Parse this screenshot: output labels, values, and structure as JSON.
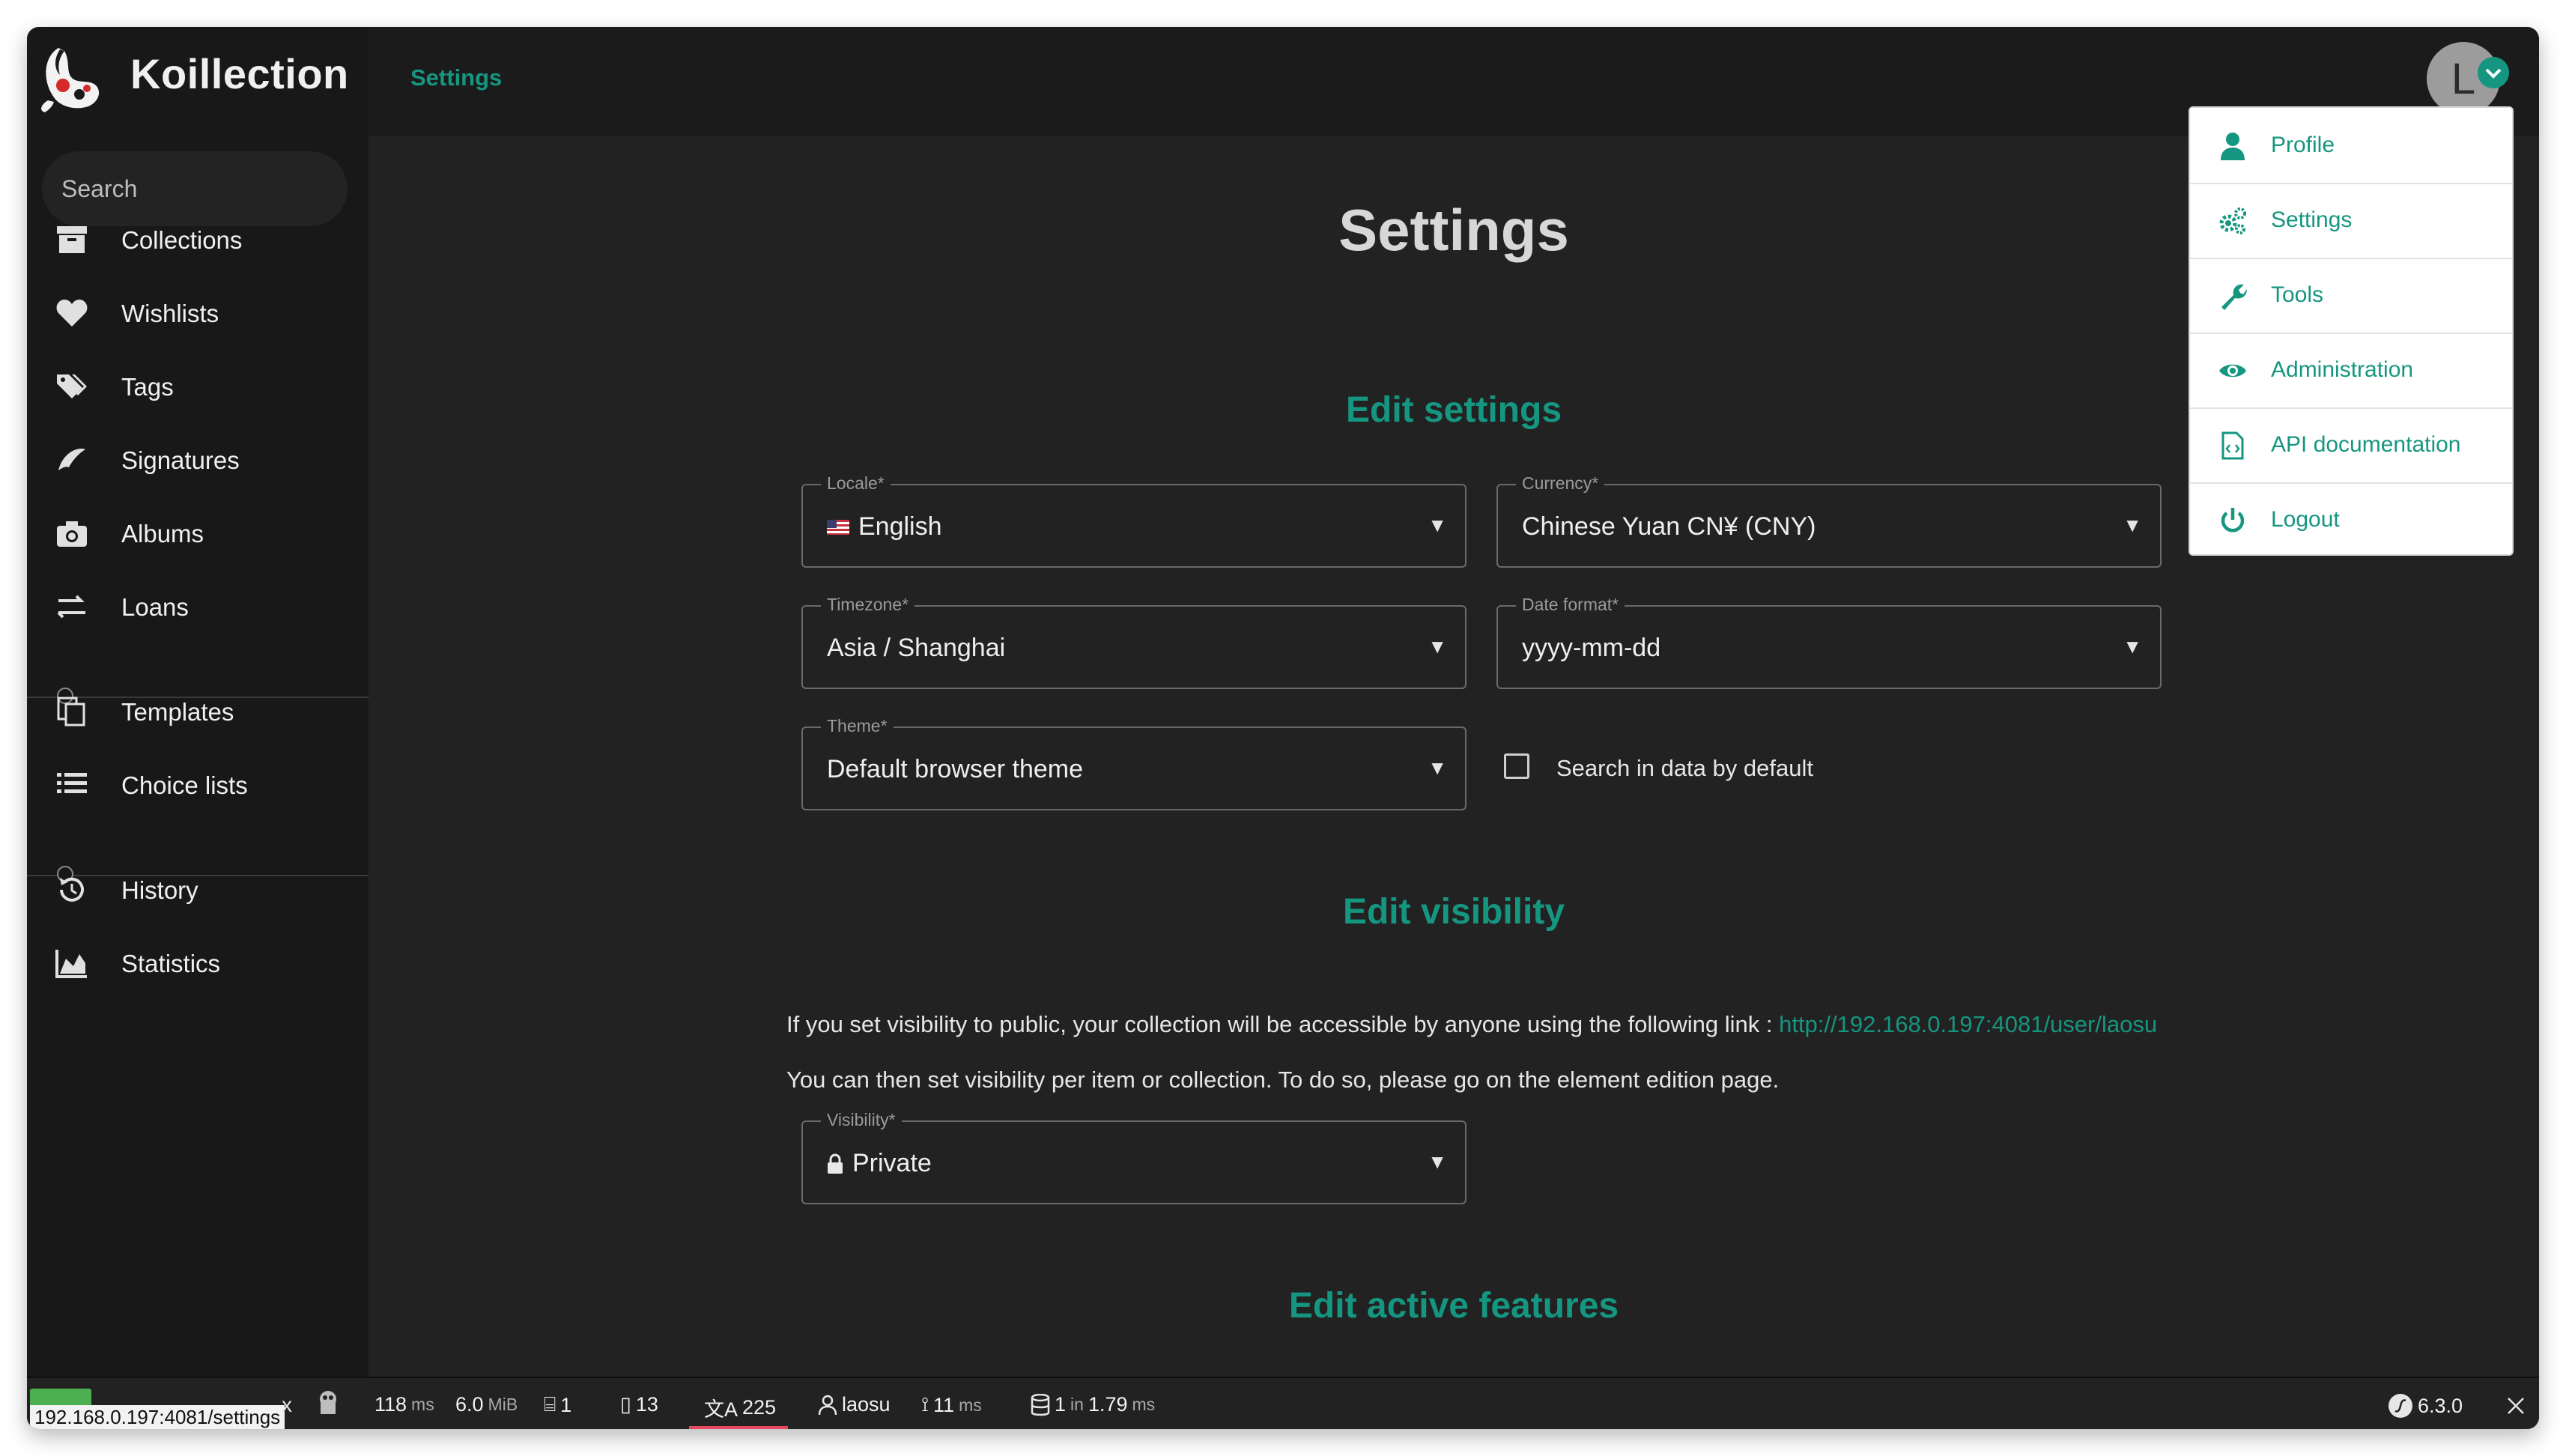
{
  "app": {
    "name": "Koillection"
  },
  "search": {
    "placeholder": "Search"
  },
  "sidebar": {
    "items": [
      {
        "label": "Collections",
        "icon": "archive-icon"
      },
      {
        "label": "Wishlists",
        "icon": "heart-icon"
      },
      {
        "label": "Tags",
        "icon": "tags-icon"
      },
      {
        "label": "Signatures",
        "icon": "signature-icon"
      },
      {
        "label": "Albums",
        "icon": "camera-icon"
      },
      {
        "label": "Loans",
        "icon": "exchange-icon"
      },
      {
        "label": "Templates",
        "icon": "copy-icon"
      },
      {
        "label": "Choice lists",
        "icon": "list-icon"
      },
      {
        "label": "History",
        "icon": "history-icon"
      },
      {
        "label": "Statistics",
        "icon": "chart-area-icon"
      }
    ]
  },
  "header": {
    "breadcrumb": "Settings",
    "avatar_initial": "L"
  },
  "user_menu": {
    "items": [
      {
        "label": "Profile",
        "icon": "user-icon"
      },
      {
        "label": "Settings",
        "icon": "cogs-icon"
      },
      {
        "label": "Tools",
        "icon": "wrench-icon"
      },
      {
        "label": "Administration",
        "icon": "eye-icon"
      },
      {
        "label": "API documentation",
        "icon": "file-code-icon"
      },
      {
        "label": "Logout",
        "icon": "power-icon"
      }
    ]
  },
  "main": {
    "title": "Settings",
    "edit_settings": {
      "title": "Edit settings",
      "locale": {
        "label": "Locale*",
        "value": "English"
      },
      "currency": {
        "label": "Currency*",
        "value": "Chinese Yuan CN¥ (CNY)"
      },
      "timezone": {
        "label": "Timezone*",
        "value": "Asia / Shanghai"
      },
      "date_format": {
        "label": "Date format*",
        "value": "yyyy-mm-dd"
      },
      "theme": {
        "label": "Theme*",
        "value": "Default browser theme"
      },
      "search_in_data": {
        "label": "Search in data by default",
        "checked": false
      }
    },
    "edit_visibility": {
      "title": "Edit visibility",
      "intro": "If you set visibility to public, your collection will be accessible by anyone using the following link :",
      "link": "http://192.168.0.197:4081/user/laosu",
      "note": "You can then set visibility per item or collection. To do so, please go on the element edition page.",
      "visibility": {
        "label": "Visibility*",
        "value": "Private"
      }
    },
    "edit_active_features": {
      "title": "Edit active features"
    }
  },
  "debug_toolbar": {
    "url": "192.168.0.197:4081/settings",
    "close_x": "x",
    "time": "118",
    "time_unit": "ms",
    "memory": "6.0",
    "memory_unit": "MiB",
    "logs": "1",
    "forms": "13",
    "translations": "225",
    "user": "laosu",
    "twig_time": "11",
    "twig_unit": "ms",
    "db_queries": "1",
    "db_in": "in",
    "db_time": "1.79",
    "db_unit": "ms",
    "symfony_version": "6.3.0"
  },
  "colors": {
    "accent": "#159680",
    "background": "#222222",
    "sidebar": "#181818",
    "menu_bg": "#ffffff"
  }
}
